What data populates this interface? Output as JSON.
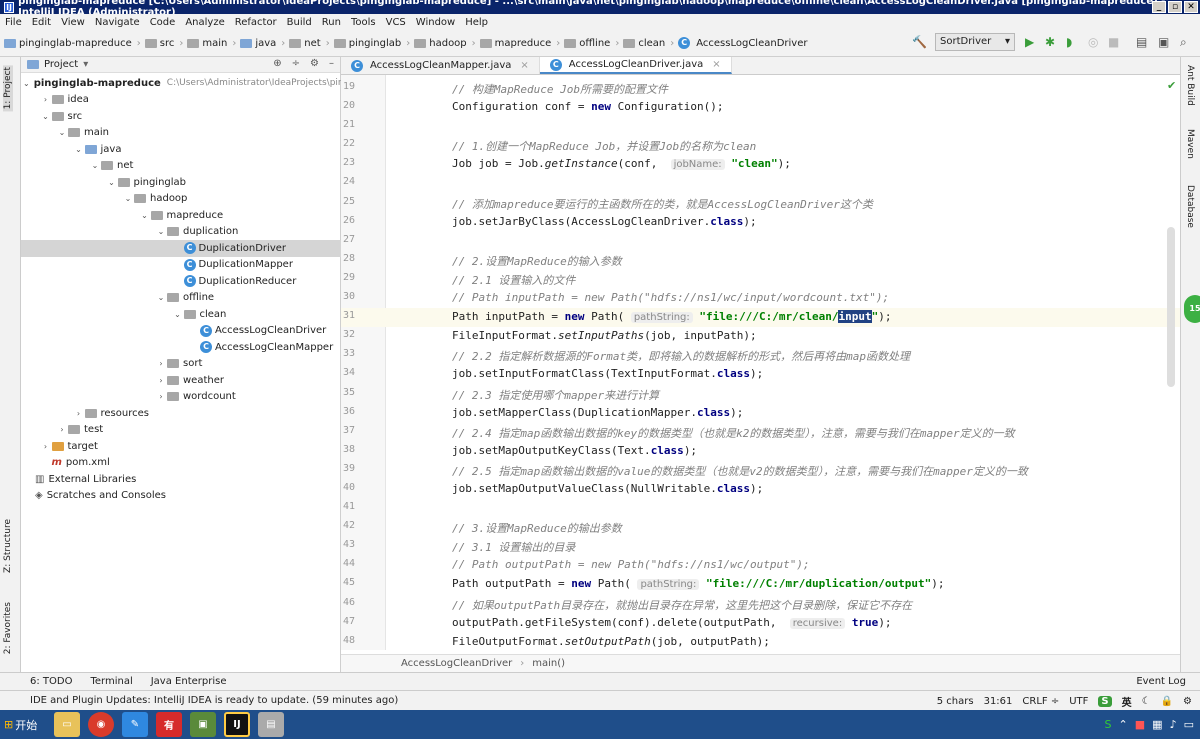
{
  "window": {
    "title": "pinginglab-mapreduce [C:\\Users\\Administrator\\IdeaProjects\\pinginglab-mapreduce] - ...\\src\\main\\java\\net\\pinginglab\\hadoop\\mapreduce\\offline\\clean\\AccessLogCleanDriver.java [pinginglab-mapreduce] - IntelliJ IDEA (Administrator)"
  },
  "menu": [
    "File",
    "Edit",
    "View",
    "Navigate",
    "Code",
    "Analyze",
    "Refactor",
    "Build",
    "Run",
    "Tools",
    "VCS",
    "Window",
    "Help"
  ],
  "breadcrumbs": [
    "pinginglab-mapreduce",
    "src",
    "main",
    "java",
    "net",
    "pinginglab",
    "hadoop",
    "mapreduce",
    "offline",
    "clean",
    "AccessLogCleanDriver"
  ],
  "run_config": "SortDriver",
  "left_tools": {
    "project": "1: Project",
    "structure": "Z: Structure",
    "favorites": "2: Favorites"
  },
  "right_tools": [
    "Ant Build",
    "Maven",
    "Database"
  ],
  "project_panel": {
    "title": "Project",
    "root_name": "pinginglab-mapreduce",
    "root_path": "C:\\Users\\Administrator\\IdeaProjects\\pinginglab"
  },
  "tree": [
    {
      "d": 1,
      "a": "›",
      "label": "idea",
      "icon": "folder"
    },
    {
      "d": 1,
      "a": "⌄",
      "label": "src",
      "icon": "folder"
    },
    {
      "d": 2,
      "a": "⌄",
      "label": "main",
      "icon": "folder"
    },
    {
      "d": 3,
      "a": "⌄",
      "label": "java",
      "icon": "folder-blue"
    },
    {
      "d": 4,
      "a": "⌄",
      "label": "net",
      "icon": "package"
    },
    {
      "d": 5,
      "a": "⌄",
      "label": "pinginglab",
      "icon": "package"
    },
    {
      "d": 6,
      "a": "⌄",
      "label": "hadoop",
      "icon": "package"
    },
    {
      "d": 7,
      "a": "⌄",
      "label": "mapreduce",
      "icon": "package"
    },
    {
      "d": 8,
      "a": "⌄",
      "label": "duplication",
      "icon": "package"
    },
    {
      "d": 9,
      "a": "",
      "label": "DuplicationDriver",
      "icon": "class",
      "sel": true
    },
    {
      "d": 9,
      "a": "",
      "label": "DuplicationMapper",
      "icon": "class"
    },
    {
      "d": 9,
      "a": "",
      "label": "DuplicationReducer",
      "icon": "class"
    },
    {
      "d": 8,
      "a": "⌄",
      "label": "offline",
      "icon": "package"
    },
    {
      "d": 9,
      "a": "⌄",
      "label": "clean",
      "icon": "package"
    },
    {
      "d": 10,
      "a": "",
      "label": "AccessLogCleanDriver",
      "icon": "class"
    },
    {
      "d": 10,
      "a": "",
      "label": "AccessLogCleanMapper",
      "icon": "class"
    },
    {
      "d": 8,
      "a": "›",
      "label": "sort",
      "icon": "package"
    },
    {
      "d": 8,
      "a": "›",
      "label": "weather",
      "icon": "package"
    },
    {
      "d": 8,
      "a": "›",
      "label": "wordcount",
      "icon": "package"
    },
    {
      "d": 3,
      "a": "›",
      "label": "resources",
      "icon": "folder"
    },
    {
      "d": 2,
      "a": "›",
      "label": "test",
      "icon": "folder"
    },
    {
      "d": 1,
      "a": "›",
      "label": "target",
      "icon": "folder-orange"
    },
    {
      "d": 1,
      "a": "",
      "label": "pom.xml",
      "icon": "maven"
    },
    {
      "d": 0,
      "a": "",
      "label": "External Libraries",
      "icon": "lib"
    },
    {
      "d": 0,
      "a": "",
      "label": "Scratches and Consoles",
      "icon": "scratch"
    }
  ],
  "tabs": [
    {
      "label": "AccessLogCleanMapper.java",
      "active": false
    },
    {
      "label": "AccessLogCleanDriver.java",
      "active": true
    }
  ],
  "code": [
    {
      "n": "19",
      "h": "<span class=\"cm\">// 构建MapReduce Job所需要的配置文件</span>"
    },
    {
      "n": "20",
      "h": "Configuration conf = <span class=\"kw\">new</span> Configuration();"
    },
    {
      "n": "21",
      "h": ""
    },
    {
      "n": "22",
      "h": "<span class=\"cm\">// 1.创建一个MapReduce Job，并设置Job的名称为clean</span>"
    },
    {
      "n": "23",
      "h": "Job job = Job.<span class=\"fn\">getInstance</span>(conf,  <span class=\"hint\">jobName:</span> <span class=\"str\">\"clean\"</span>);"
    },
    {
      "n": "24",
      "h": ""
    },
    {
      "n": "25",
      "h": "<span class=\"cm\">// 添加mapreduce要运行的主函数所在的类，就是AccessLogCleanDriver这个类</span>"
    },
    {
      "n": "26",
      "h": "job.setJarByClass(AccessLogCleanDriver.<span class=\"kw\">class</span>);"
    },
    {
      "n": "27",
      "h": ""
    },
    {
      "n": "28",
      "h": "<span class=\"cm\">// 2.设置MapReduce的输入参数</span>"
    },
    {
      "n": "29",
      "h": "<span class=\"cm\">// 2.1 设置输入的文件</span>"
    },
    {
      "n": "30",
      "h": "<span class=\"cm\">// Path inputPath = new Path(\"hdfs://ns1/wc/input/wordcount.txt\");</span>"
    },
    {
      "n": "31",
      "h": "Path inputPath = <span class=\"kw\">new</span> Path( <span class=\"hint\">pathString:</span> <span class=\"str\">\"file:///C:/mr/clean/<span class=\"selw\">input</span>\"</span>);",
      "cur": true
    },
    {
      "n": "32",
      "h": "FileInputFormat.<span class=\"fn\">setInputPaths</span>(job, inputPath);"
    },
    {
      "n": "33",
      "h": "<span class=\"cm\">// 2.2 指定解析数据源的Format类，即将输入的数据解析<k1,v1>的形式，然后再将由map函数处理</span>"
    },
    {
      "n": "34",
      "h": "job.setInputFormatClass(TextInputFormat.<span class=\"kw\">class</span>);"
    },
    {
      "n": "35",
      "h": "<span class=\"cm\">// 2.3 指定使用哪个mapper来进行计算</span>"
    },
    {
      "n": "36",
      "h": "job.setMapperClass(DuplicationMapper.<span class=\"kw\">class</span>);"
    },
    {
      "n": "37",
      "h": "<span class=\"cm\">// 2.4 指定map函数输出数据的key的数据类型（也就是k2的数据类型），注意，需要与我们在mapper定义的一致</span>"
    },
    {
      "n": "38",
      "h": "job.setMapOutputKeyClass(Text.<span class=\"kw\">class</span>);"
    },
    {
      "n": "39",
      "h": "<span class=\"cm\">// 2.5 指定map函数输出数据的value的数据类型（也就是v2的数据类型），注意，需要与我们在mapper定义的一致</span>"
    },
    {
      "n": "40",
      "h": "job.setMapOutputValueClass(NullWritable.<span class=\"kw\">class</span>);"
    },
    {
      "n": "41",
      "h": ""
    },
    {
      "n": "42",
      "h": "<span class=\"cm\">// 3.设置MapReduce的输出参数</span>"
    },
    {
      "n": "43",
      "h": "<span class=\"cm\">// 3.1 设置输出的目录</span>"
    },
    {
      "n": "44",
      "h": "<span class=\"cm\">// Path outputPath = new Path(\"hdfs://ns1/wc/output\");</span>"
    },
    {
      "n": "45",
      "h": "Path outputPath = <span class=\"kw\">new</span> Path( <span class=\"hint\">pathString:</span> <span class=\"str\">\"file:///C:/mr/duplication/output\"</span>);"
    },
    {
      "n": "46",
      "h": "<span class=\"cm\">// 如果outputPath目录存在，就抛出目录存在异常，这里先把这个目录删除，保证它不存在</span>"
    },
    {
      "n": "47",
      "h": "outputPath.getFileSystem(conf).delete(outputPath,  <span class=\"hint\">recursive:</span> <span class=\"kw\">true</span>);"
    },
    {
      "n": "48",
      "h": "FileOutputFormat.<span class=\"fn\">setOutputPath</span>(job, outputPath);"
    }
  ],
  "editor_breadcrumb": [
    "AccessLogCleanDriver",
    "main()"
  ],
  "badge": "15",
  "bottom_tools": [
    "6: TODO",
    "Terminal",
    "Java Enterprise"
  ],
  "event_log": "Event Log",
  "status": {
    "message": "IDE and Plugin Updates: IntelliJ IDEA is ready to update. (59 minutes ago)",
    "chars": "5 chars",
    "pos": "31:61",
    "crlf": "CRLF ÷",
    "enc": "UTF"
  },
  "taskbar": {
    "start": "开始",
    "ime": "英"
  }
}
